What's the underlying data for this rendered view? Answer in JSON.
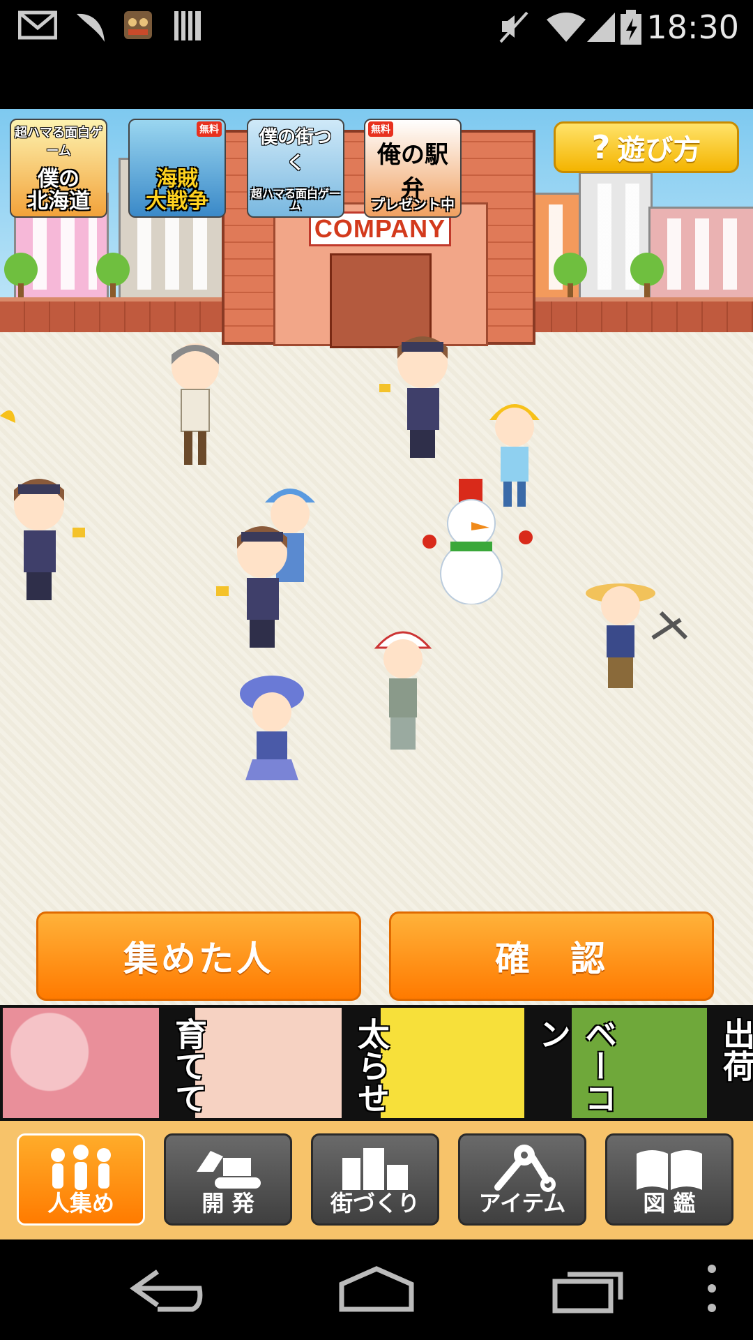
{
  "status_bar": {
    "time": "18:30",
    "icons": [
      "gmail-icon",
      "feather-icon",
      "app-icon",
      "barcode-icon",
      "mute-icon",
      "wifi-icon",
      "signal-icon",
      "battery-icon"
    ]
  },
  "promos": [
    {
      "top": "超ハマる面白ゲーム",
      "title": "僕の\n北海道",
      "free": ""
    },
    {
      "top": "",
      "title": "海賊\n大戦争",
      "free": "無料"
    },
    {
      "top": "",
      "title": "僕の街つく",
      "free": "",
      "bottom": "超ハマる面白ゲーム"
    },
    {
      "top": "",
      "title": "俺の駅弁",
      "free": "無料",
      "bottom": "プレゼント中"
    }
  ],
  "scene": {
    "company_sign": "COMPANY",
    "howto_label": "遊び方"
  },
  "actions": {
    "collected_label": "集めた人",
    "confirm_label": "確　認"
  },
  "ad_banner": {
    "words": [
      "育てて",
      "太らせ",
      "ベーコン",
      "出荷"
    ]
  },
  "tabs": [
    {
      "label": "人集め",
      "icon": "people-icon",
      "active": true
    },
    {
      "label": "開 発",
      "icon": "excavator-icon",
      "active": false
    },
    {
      "label": "街づくり",
      "icon": "buildings-icon",
      "active": false
    },
    {
      "label": "アイテム",
      "icon": "tools-icon",
      "active": false
    },
    {
      "label": "図 鑑",
      "icon": "book-icon",
      "active": false
    }
  ],
  "nav": {
    "icons": [
      "back-icon",
      "home-icon",
      "recents-icon",
      "menu-icon"
    ]
  },
  "colors": {
    "accent_orange": "#ff8a00",
    "tab_dark": "#4a4a4a",
    "tabbar_bg": "#f7c36a"
  }
}
